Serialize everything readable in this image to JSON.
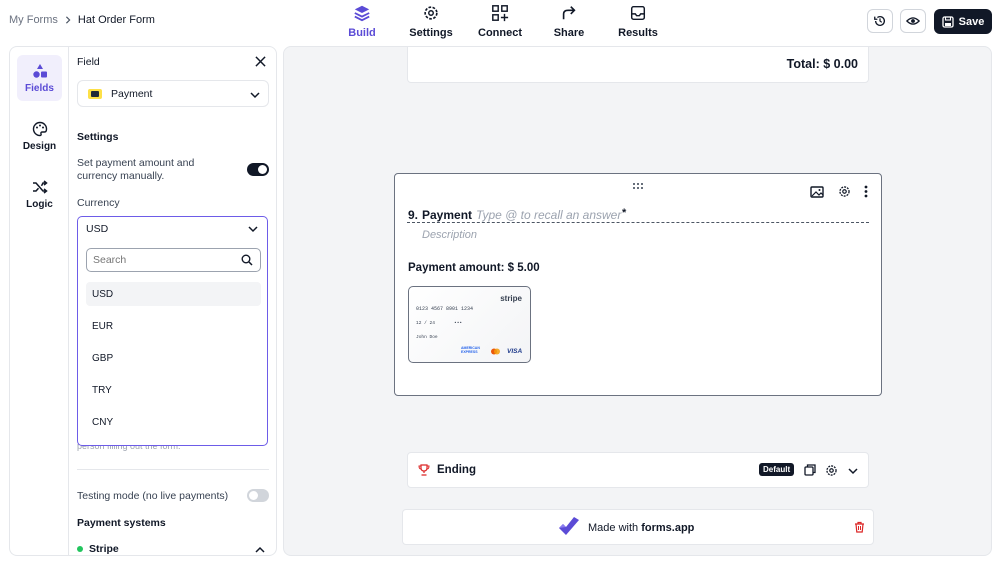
{
  "breadcrumb": {
    "parent": "My Forms",
    "current": "Hat Order Form"
  },
  "nav": [
    {
      "label": "Build",
      "active": true
    },
    {
      "label": "Settings",
      "active": false
    },
    {
      "label": "Connect",
      "active": false
    },
    {
      "label": "Share",
      "active": false
    },
    {
      "label": "Results",
      "active": false
    }
  ],
  "header_actions": {
    "save_label": "Save"
  },
  "rail": [
    {
      "label": "Fields",
      "active": true
    },
    {
      "label": "Design",
      "active": false
    },
    {
      "label": "Logic",
      "active": false
    }
  ],
  "panel": {
    "title": "Field",
    "field_type": "Payment",
    "settings_heading": "Settings",
    "manual_label": "Set payment amount and currency manually.",
    "manual_enabled": true,
    "currency_label": "Currency",
    "currency_value": "USD",
    "search_placeholder": "Search",
    "currency_options": [
      "USD",
      "EUR",
      "GBP",
      "TRY",
      "CNY"
    ],
    "obscured_text": "person filling out the form.",
    "testing_label": "Testing mode (no live payments)",
    "testing_enabled": false,
    "payment_systems_heading": "Payment systems",
    "stripe_label": "Stripe"
  },
  "canvas": {
    "total_label": "Total: $ 0.00",
    "question": {
      "number": "9.",
      "title": "Payment",
      "recall_placeholder": "Type @ to recall an answer",
      "required_mark": "*",
      "description_placeholder": "Description",
      "amount_text": "Payment amount: $ 5.00",
      "card": {
        "brand": "stripe",
        "number": "0123 4567 8901 1234",
        "expiry": "12 / 24",
        "cvc": "•••",
        "name": "John Doe",
        "logos": [
          "AMERICAN EXPRESS",
          "VISA"
        ]
      }
    },
    "ending": {
      "label": "Ending",
      "badge": "Default"
    },
    "footer": {
      "prefix": "Made with",
      "brand": "forms.app"
    }
  },
  "colors": {
    "accent": "#5b4bd6",
    "dark": "#111827",
    "delete": "#dc2626"
  }
}
